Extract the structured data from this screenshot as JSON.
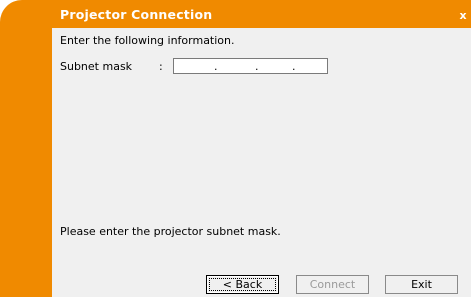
{
  "window": {
    "title": "Projector Connection",
    "close_glyph": "x",
    "colors": {
      "frame": "#f08a00",
      "content": "#f0f0f0",
      "title_text": "#ffffff"
    }
  },
  "main": {
    "instruction": "Enter the following information.",
    "subnet": {
      "label": "Subnet mask",
      "colon": ":",
      "segments": [
        "",
        "",
        "",
        ""
      ],
      "separator": "."
    },
    "hint": "Please enter the projector subnet mask."
  },
  "buttons": {
    "back": {
      "label": "< Back",
      "state": "focused"
    },
    "connect": {
      "label": "Connect",
      "state": "disabled"
    },
    "exit": {
      "label": "Exit",
      "state": "enabled"
    }
  }
}
